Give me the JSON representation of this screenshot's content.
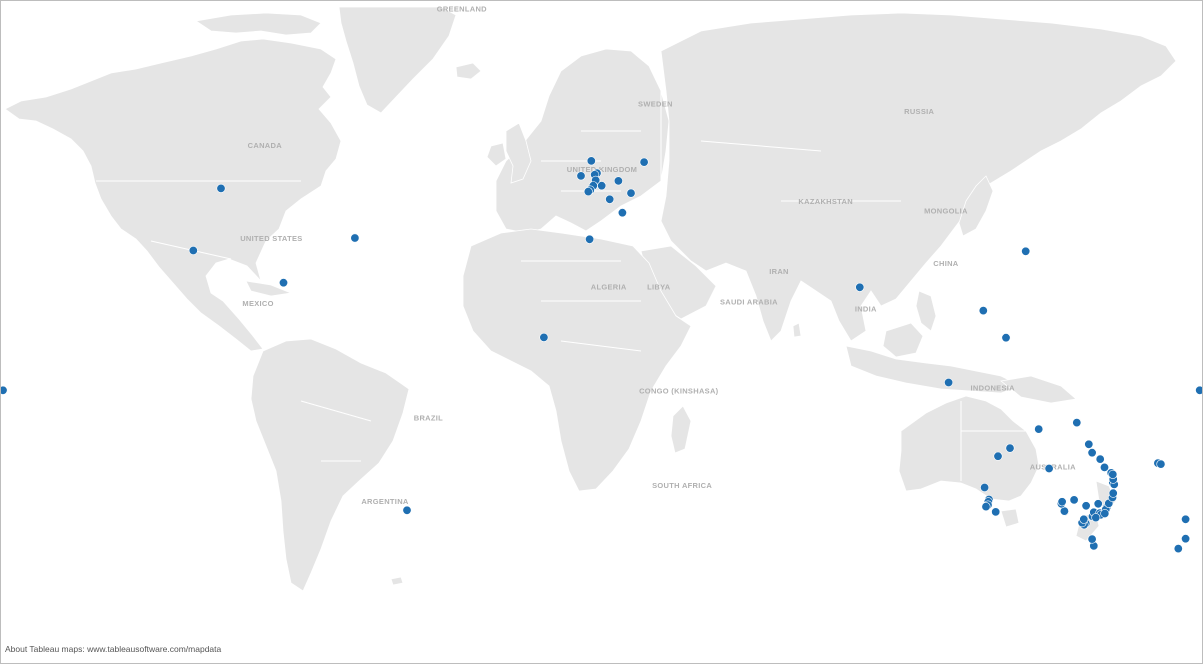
{
  "map": {
    "attribution": "About Tableau maps: www.tableausoftware.com/mapdata",
    "marker_color": "#1f6fb2",
    "land_color": "#e5e5e5",
    "country_labels": [
      {
        "key": "greenland",
        "text": "GREENLAND",
        "lon": -42,
        "lat": 74
      },
      {
        "key": "canada",
        "text": "CANADA",
        "lon": -101,
        "lat": 58
      },
      {
        "key": "united_states",
        "text": "UNITED STATES",
        "lon": -99,
        "lat": 40
      },
      {
        "key": "mexico",
        "text": "MEXICO",
        "lon": -103,
        "lat": 23.5
      },
      {
        "key": "brazil",
        "text": "BRAZIL",
        "lon": -52,
        "lat": -10
      },
      {
        "key": "argentina",
        "text": "ARGENTINA",
        "lon": -65,
        "lat": -33
      },
      {
        "key": "sweden",
        "text": "SWEDEN",
        "lon": 16,
        "lat": 64
      },
      {
        "key": "united_kingdom",
        "text": "UNITED KINGDOM",
        "lon": 0,
        "lat": 54
      },
      {
        "key": "russia",
        "text": "RUSSIA",
        "lon": 95,
        "lat": 63
      },
      {
        "key": "kazakhstan",
        "text": "KAZAKHSTAN",
        "lon": 67,
        "lat": 48
      },
      {
        "key": "mongolia",
        "text": "MONGOLIA",
        "lon": 103,
        "lat": 46
      },
      {
        "key": "china",
        "text": "CHINA",
        "lon": 103,
        "lat": 34
      },
      {
        "key": "iran",
        "text": "IRAN",
        "lon": 53,
        "lat": 32
      },
      {
        "key": "india",
        "text": "INDIA",
        "lon": 79,
        "lat": 22
      },
      {
        "key": "algeria",
        "text": "ALGERIA",
        "lon": 2,
        "lat": 28
      },
      {
        "key": "libya",
        "text": "LIBYA",
        "lon": 17,
        "lat": 28
      },
      {
        "key": "saudi_arabia",
        "text": "SAUDI ARABIA",
        "lon": 44,
        "lat": 24
      },
      {
        "key": "congo",
        "text": "CONGO (KINSHASA)",
        "lon": 23,
        "lat": -2
      },
      {
        "key": "south_africa",
        "text": "SOUTH AFRICA",
        "lon": 24,
        "lat": -29
      },
      {
        "key": "indonesia",
        "text": "INDONESIA",
        "lon": 117,
        "lat": -1
      },
      {
        "key": "australia",
        "text": "AUSTRALIA",
        "lon": 135,
        "lat": -24
      }
    ],
    "locations": [
      {
        "lon": -114.1,
        "lat": 51.0
      },
      {
        "lon": -122.4,
        "lat": 37.8
      },
      {
        "lon": -95.4,
        "lat": 29.8
      },
      {
        "lon": -74.0,
        "lat": 40.7
      },
      {
        "lon": -58.4,
        "lat": -34.6
      },
      {
        "lon": -17.4,
        "lat": 14.7
      },
      {
        "lon": -180.0,
        "lat": -1.0
      },
      {
        "lon": 179.0,
        "lat": -1.0
      },
      {
        "lon": -6.3,
        "lat": 53.3
      },
      {
        "lon": -3.2,
        "lat": 55.9
      },
      {
        "lon": -1.5,
        "lat": 53.8
      },
      {
        "lon": -2.2,
        "lat": 53.5
      },
      {
        "lon": -1.9,
        "lat": 52.5
      },
      {
        "lon": -0.1,
        "lat": 51.5
      },
      {
        "lon": -2.6,
        "lat": 51.5
      },
      {
        "lon": -3.5,
        "lat": 50.7
      },
      {
        "lon": -4.1,
        "lat": 50.4
      },
      {
        "lon": 2.3,
        "lat": 48.9
      },
      {
        "lon": 4.9,
        "lat": 52.4
      },
      {
        "lon": 8.7,
        "lat": 50.1
      },
      {
        "lon": 6.1,
        "lat": 46.2
      },
      {
        "lon": 12.6,
        "lat": 55.7
      },
      {
        "lon": -3.7,
        "lat": 40.4
      },
      {
        "lon": 77.2,
        "lat": 28.6
      },
      {
        "lon": 114.2,
        "lat": 22.3
      },
      {
        "lon": 103.8,
        "lat": 1.35
      },
      {
        "lon": 121.0,
        "lat": 14.6
      },
      {
        "lon": 126.9,
        "lat": 37.6
      },
      {
        "lon": 166.5,
        "lat": -22.2
      },
      {
        "lon": 167.4,
        "lat": -22.5
      },
      {
        "lon": 174.8,
        "lat": -36.8
      },
      {
        "lon": 174.8,
        "lat": -41.3
      },
      {
        "lon": 172.6,
        "lat": -43.5
      },
      {
        "lon": 115.9,
        "lat": -31.9
      },
      {
        "lon": 115.7,
        "lat": -32.5
      },
      {
        "lon": 115.6,
        "lat": -33.3
      },
      {
        "lon": 115.0,
        "lat": -33.7
      },
      {
        "lon": 117.9,
        "lat": -35.0
      },
      {
        "lon": 114.6,
        "lat": -28.8
      },
      {
        "lon": 118.6,
        "lat": -20.3
      },
      {
        "lon": 122.2,
        "lat": -18.0
      },
      {
        "lon": 130.8,
        "lat": -12.5
      },
      {
        "lon": 133.9,
        "lat": -23.7
      },
      {
        "lon": 138.6,
        "lat": -34.9
      },
      {
        "lon": 138.5,
        "lat": -34.8
      },
      {
        "lon": 137.6,
        "lat": -33.0
      },
      {
        "lon": 137.8,
        "lat": -32.5
      },
      {
        "lon": 144.9,
        "lat": -37.8
      },
      {
        "lon": 144.4,
        "lat": -38.1
      },
      {
        "lon": 143.8,
        "lat": -37.6
      },
      {
        "lon": 144.3,
        "lat": -36.8
      },
      {
        "lon": 146.9,
        "lat": -36.1
      },
      {
        "lon": 147.3,
        "lat": -42.9
      },
      {
        "lon": 146.8,
        "lat": -41.4
      },
      {
        "lon": 147.3,
        "lat": -35.1
      },
      {
        "lon": 149.1,
        "lat": -35.3
      },
      {
        "lon": 151.2,
        "lat": -33.9
      },
      {
        "lon": 150.9,
        "lat": -34.4
      },
      {
        "lon": 151.8,
        "lat": -32.9
      },
      {
        "lon": 153.0,
        "lat": -27.5
      },
      {
        "lon": 153.4,
        "lat": -28.0
      },
      {
        "lon": 153.1,
        "lat": -26.6
      },
      {
        "lon": 150.5,
        "lat": -23.4
      },
      {
        "lon": 149.2,
        "lat": -21.1
      },
      {
        "lon": 146.8,
        "lat": -19.3
      },
      {
        "lon": 145.8,
        "lat": -16.9
      },
      {
        "lon": 142.2,
        "lat": -10.6
      },
      {
        "lon": 152.9,
        "lat": -31.4
      },
      {
        "lon": 153.1,
        "lat": -30.3
      },
      {
        "lon": 149.4,
        "lat": -35.7
      },
      {
        "lon": 150.6,
        "lat": -35.4
      },
      {
        "lon": 141.4,
        "lat": -32.0
      },
      {
        "lon": 147.9,
        "lat": -36.4
      },
      {
        "lon": 145.0,
        "lat": -33.5
      },
      {
        "lon": 148.6,
        "lat": -33.0
      },
      {
        "lon": 152.5,
        "lat": -24.9
      },
      {
        "lon": 153.0,
        "lat": -25.3
      }
    ]
  }
}
